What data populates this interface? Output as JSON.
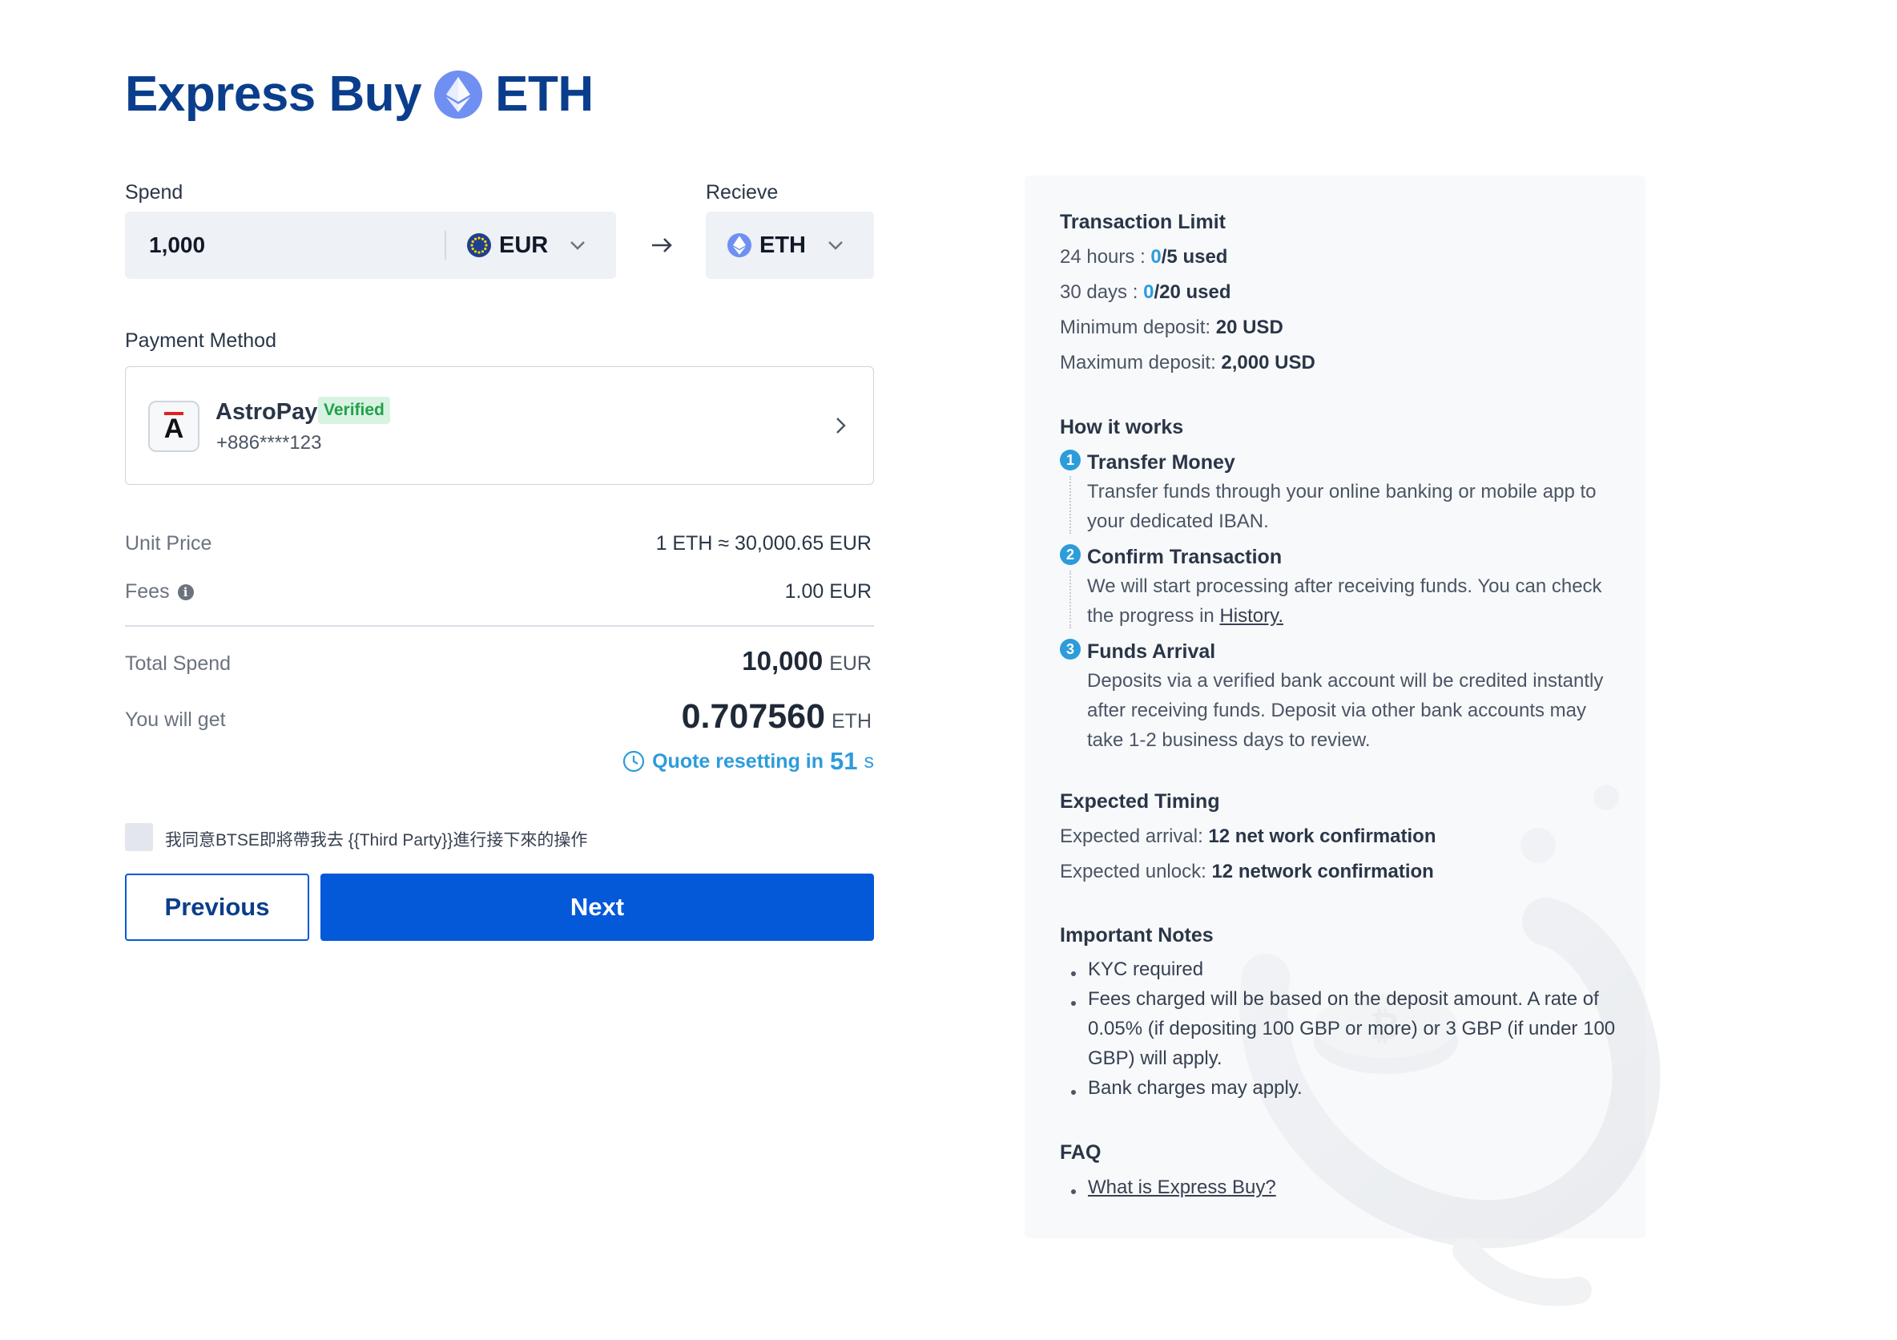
{
  "header": {
    "title_prefix": "Express Buy",
    "title_coin": "ETH",
    "coin_icon": "ethereum-icon"
  },
  "spend": {
    "label": "Spend",
    "amount": "1,000",
    "currency": "EUR",
    "currency_icon": "eur-flag-icon"
  },
  "receive": {
    "label": "Recieve",
    "currency": "ETH",
    "currency_icon": "ethereum-icon"
  },
  "payment": {
    "label": "Payment Method",
    "provider": "AstroPay",
    "provider_logo_letter": "A",
    "badge": "Verified",
    "account": "+886****123"
  },
  "summary": {
    "unit_price_label": "Unit Price",
    "unit_price_value": "1 ETH ≈ 30,000.65 EUR",
    "fees_label": "Fees",
    "fees_value": "1.00 EUR",
    "total_label": "Total Spend",
    "total_amount": "10,000",
    "total_unit": "EUR",
    "get_label": "You will get",
    "get_amount": "0.707560",
    "get_unit": "ETH",
    "quote_text": "Quote resetting in",
    "quote_seconds": "51",
    "quote_unit": "s"
  },
  "agreement": {
    "text": "我同意BTSE即將帶我去 {{Third Party}}進行接下來的操作",
    "checked": false
  },
  "buttons": {
    "previous": "Previous",
    "next": "Next"
  },
  "panel": {
    "limit": {
      "title": "Transaction Limit",
      "day_label": "24 hours :",
      "day_used": "0",
      "day_rest": "/5 used",
      "month_label": "30 days :",
      "month_used": "0",
      "month_rest": "/20 used",
      "min_label": "Minimum deposit:",
      "min_value": "20 USD",
      "max_label": "Maximum deposit:",
      "max_value": "2,000 USD"
    },
    "how": {
      "title": "How it works",
      "steps": [
        {
          "num": "1",
          "title": "Transfer Money",
          "body": "Transfer funds through your online banking or mobile app to your dedicated IBAN."
        },
        {
          "num": "2",
          "title": "Confirm Transaction",
          "body": "We will start processing after receiving funds. You can check the progress in",
          "link": "History."
        },
        {
          "num": "3",
          "title": "Funds Arrival",
          "body": "Deposits via a verified bank account will be credited instantly after receiving funds. Deposit via other bank accounts may take 1-2 business days to review."
        }
      ]
    },
    "timing": {
      "title": "Expected Timing",
      "arrival_label": "Expected arrival:",
      "arrival_value": "12 net work confirmation",
      "unlock_label": "Expected unlock:",
      "unlock_value": "12 network confirmation"
    },
    "notes": {
      "title": "Important Notes",
      "items": [
        "KYC required",
        "Fees charged will be based on the deposit amount. A rate of 0.05% (if depositing 100 GBP or more) or 3 GBP (if under 100 GBP) will apply.",
        "Bank charges may apply."
      ]
    },
    "faq": {
      "title": "FAQ",
      "items": [
        "What is Express Buy?"
      ]
    }
  },
  "colors": {
    "brand_blue": "#0459d9",
    "title_blue": "#0a3e8c",
    "accent_cyan": "#2d9cdb",
    "verified_green": "#22a14a"
  }
}
